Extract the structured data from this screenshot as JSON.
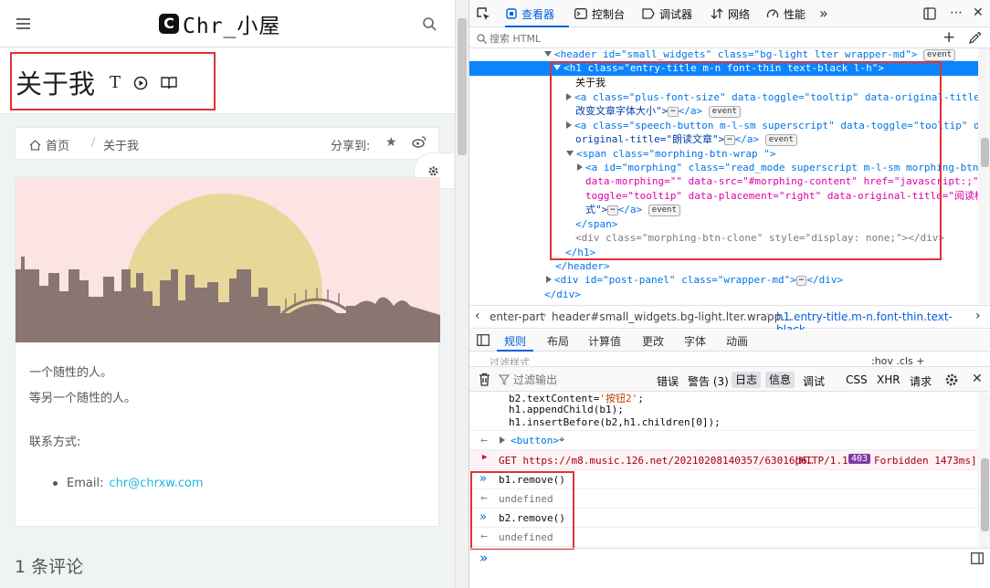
{
  "blog": {
    "logo_letter": "C",
    "logo_text": "Chr_小屋",
    "page_title": "关于我",
    "title_icons": [
      "font-size-icon",
      "play-circle-icon",
      "book-icon"
    ],
    "breadcrumb": {
      "home": "首页",
      "separator": "/",
      "current": "关于我"
    },
    "share_label": "分享到:",
    "paragraphs": [
      "一个随性的人。",
      "等另一个随性的人。"
    ],
    "contact_label": "联系方式:",
    "email_label": "Email:",
    "email_value": "chr@chrxw.com",
    "comments": "1 条评论"
  },
  "devtools": {
    "tabs": [
      "查看器",
      "控制台",
      "调试器",
      "网络",
      "性能"
    ],
    "search_placeholder": "搜索 HTML",
    "markup": {
      "l0a": "<header id=\"small_widgets\" class=\"bg-light lter wrapper-md\">",
      "l1a": "<h1 class=\"entry-title m-n font-thin text-black l-h\">",
      "l2": "关于我",
      "l3a": "<a class=\"plus-font-size\" data-toggle=\"tooltip\" data-original-title=\"点击",
      "l3b": "改变文章字体大小\">",
      "l3c": "</a>",
      "l4a": "<a class=\"speech-button m-l-sm superscript\" data-toggle=\"tooltip\" data-",
      "l4b": "original-title=\"朗读文章\">",
      "l4c": "</a>",
      "l5": "<span class=\"morphing-btn-wrap \">",
      "l6a": "<a id=\"morphing\" class=\"read_mode superscript m-l-sm morphing-btn\"",
      "l6b": "data-morphing=\"\" data-src=\"#morphing-content\" href=\"javascript:;\" data-",
      "l6c": "toggle=\"tooltip\" data-placement=\"right\" data-original-title=\"阅读模",
      "l6d": "式\">",
      "l6e": "</a>",
      "l7": "</span>",
      "l8": "<div class=\"morphing-btn-clone\" style=\"display: none;\"></div>",
      "l9": "</h1>",
      "l10": "</header>",
      "l11a": "<div id=\"post-panel\" class=\"wrapper-md\">",
      "l11b": "</div>",
      "l12": "</div>",
      "event": "event",
      "ellipsis": "⋯"
    },
    "breadcrumbs": [
      "enter-part",
      "header#small_widgets.bg-light.lter.wrapp…",
      "h1.entry-title.m-n.font-thin.text-black…"
    ],
    "rule_tabs": [
      "规则",
      "布局",
      "计算值",
      "更改",
      "字体",
      "动画"
    ],
    "filter_hint": "过滤样式",
    "filter_extra": ":hov .cls +",
    "console_filter_placeholder": "过滤输出",
    "console_levels": [
      "错误",
      "警告 (3)",
      "日志",
      "信息",
      "调试"
    ],
    "console_types": [
      "CSS",
      "XHR",
      "请求"
    ],
    "console": {
      "code1": "b2.textContent='按钮2';",
      "code2": "h1.appendChild(b1);",
      "code3": "h1.insertBefore(b2,h1.children[0]);",
      "button_result": "<button>",
      "error_url": "GET https://m8.music.126.net/20210208140357/63016d6…",
      "error_status_a": "[HTTP/1.1",
      "error_code": "403",
      "error_status_b": "Forbidden 1473ms]",
      "cmd1": "b1.remove()",
      "res1": "undefined",
      "cmd2": "b2.remove()",
      "res2": "undefined"
    }
  }
}
